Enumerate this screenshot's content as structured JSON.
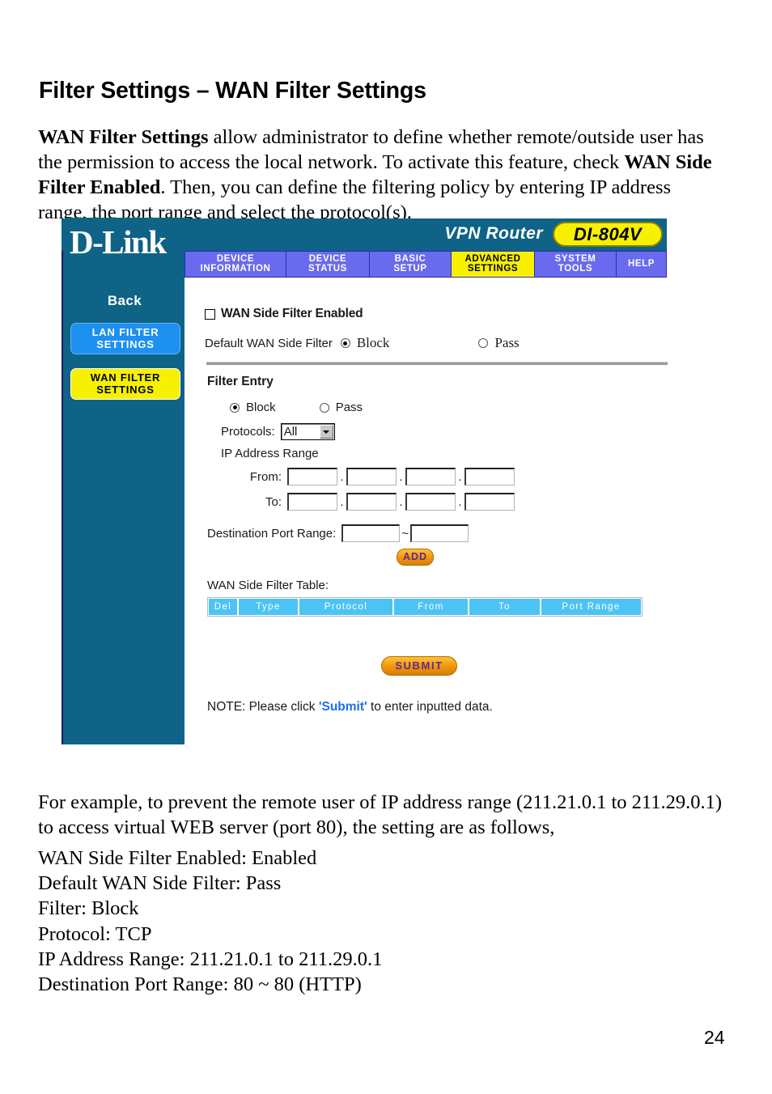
{
  "document": {
    "title": "Filter Settings – WAN Filter Settings",
    "intro": {
      "b1": "WAN Filter Settings",
      "t1": " allow administrator to define whether remote/outside user has the permission to access the local network. To activate this feature, check ",
      "b2": "WAN Side Filter Enabled",
      "t2": ". Then, you can define the filtering policy by entering IP address range, the port range and select the protocol(s)."
    },
    "example_paragraph": "For example, to prevent the remote user of IP address range (211.21.0.1 to 211.29.0.1) to access virtual WEB server (port 80), the setting are as follows,",
    "settings_lines": [
      "WAN Side Filter Enabled: Enabled",
      "Default WAN Side Filter: Pass",
      "Filter: Block",
      "Protocol: TCP",
      "IP Address Range: 211.21.0.1 to 211.29.0.1",
      "Destination Port Range: 80 ~ 80 (HTTP)"
    ],
    "page_number": "24"
  },
  "router_ui": {
    "banner": {
      "logo": "D-Link",
      "product_line": "VPN Router",
      "model": "DI-804V",
      "logo_color": "#ffffff",
      "banner_color": "#0f6386",
      "badge_color": "#f7f000"
    },
    "nav_tabs": [
      {
        "l1": "DEVICE",
        "l2": "INFORMATION",
        "active": false
      },
      {
        "l1": "DEVICE",
        "l2": "STATUS",
        "active": false
      },
      {
        "l1": "BASIC",
        "l2": "SETUP",
        "active": false
      },
      {
        "l1": "ADVANCED",
        "l2": "SETTINGS",
        "active": true
      },
      {
        "l1": "SYSTEM",
        "l2": "TOOLS",
        "active": false
      },
      {
        "l1": "HELP",
        "l2": "",
        "active": false
      }
    ],
    "sidebar": {
      "back_label": "Back",
      "buttons": [
        {
          "l1": "LAN FILTER",
          "l2": "SETTINGS",
          "active": false
        },
        {
          "l1": "WAN FILTER",
          "l2": "SETTINGS",
          "active": true
        }
      ]
    },
    "form": {
      "wan_side_filter_enabled_label": "WAN Side Filter Enabled",
      "wan_side_filter_enabled_checked": false,
      "default_filter_label": "Default WAN Side Filter",
      "default_filter_block": "Block",
      "default_filter_pass": "Pass",
      "default_filter_selected": "Block",
      "filter_entry_title": "Filter Entry",
      "entry_block": "Block",
      "entry_pass": "Pass",
      "entry_selected": "Block",
      "protocols_label": "Protocols:",
      "protocols_value": "All",
      "protocols_options": [
        "All"
      ],
      "ip_range_label": "IP Address Range",
      "from_label": "From:",
      "to_label": "To:",
      "dot": ".",
      "from_octets": [
        "",
        "",
        "",
        ""
      ],
      "to_octets": [
        "",
        "",
        "",
        ""
      ],
      "port_range_label": "Destination Port Range:",
      "port_from": "",
      "port_to": "",
      "port_separator": "~",
      "add_button": "ADD",
      "table_title": "WAN Side Filter Table:",
      "table_headers": [
        "Del",
        "Type",
        "Protocol",
        "From",
        "To",
        "Port Range"
      ],
      "table_rows": [],
      "submit_button": "SUBMIT",
      "note_prefix": "NOTE: Please click ",
      "note_highlight": "'Submit'",
      "note_suffix": " to enter inputted data."
    }
  }
}
